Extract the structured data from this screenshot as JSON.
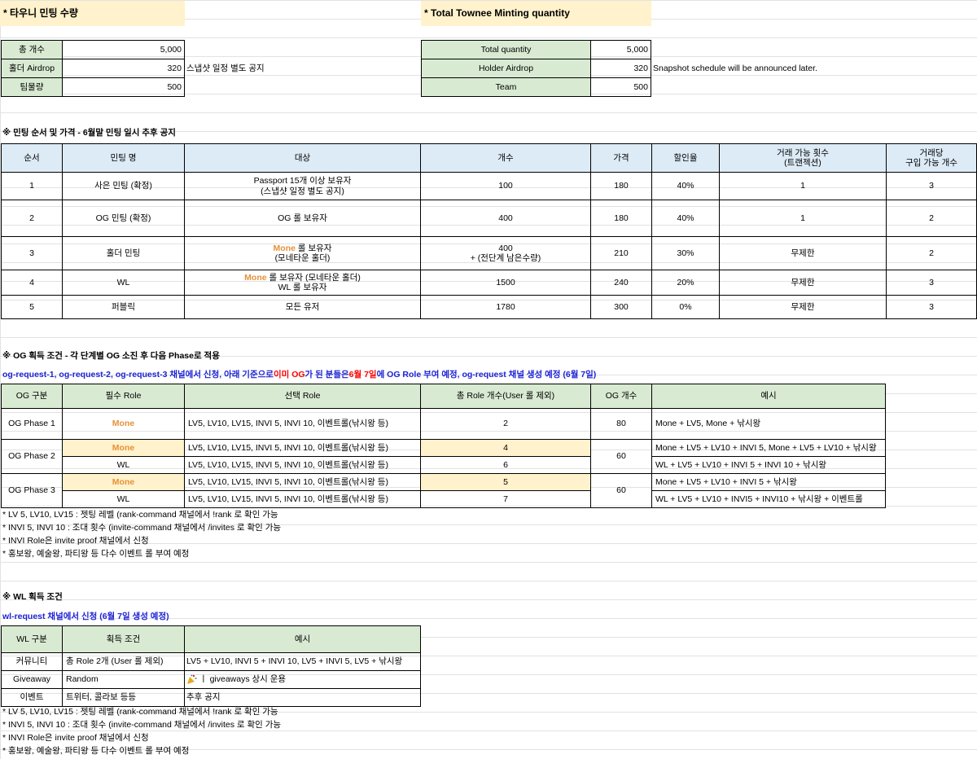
{
  "ko_title": "* 타우니 민팅 수량",
  "en_title": "* Total Townee Minting quantity",
  "ko_qty": [
    {
      "label": "총 개수",
      "value": "5,000",
      "note": ""
    },
    {
      "label": "홀더 Airdrop",
      "value": "320",
      "note": "스냅샷 일정 별도 공지"
    },
    {
      "label": "팀물량",
      "value": "500",
      "note": ""
    }
  ],
  "en_qty": [
    {
      "label": "Total quantity",
      "value": "5,000",
      "note": ""
    },
    {
      "label": "Holder Airdrop",
      "value": "320",
      "note": "Snapshot schedule will be announced later."
    },
    {
      "label": "Team",
      "value": "500",
      "note": ""
    }
  ],
  "mint_heading": "※ 민팅 순서 및 가격 - 6월말 민팅 일시 추후 공지",
  "mint_headers": [
    "순서",
    "민팅 명",
    "대상",
    "개수",
    "가격",
    "할인율",
    "거래 가능 횟수",
    "(트랜젝션)",
    "거래당",
    "구입 가능 개수"
  ],
  "mint_rows": [
    {
      "order": "1",
      "name": "사은 민팅 (확정)",
      "target1": "Passport 15개 이상 보유자",
      "target2": "(스냅샷 일정 별도 공지)",
      "qty1": "100",
      "qty2": "",
      "price": "180",
      "discount": "40%",
      "tx": "1",
      "per": "3"
    },
    {
      "order": "2",
      "name": "OG 민팅 (확정)",
      "target1": "OG 롤 보유자",
      "target2": "",
      "qty1": "400",
      "qty2": "",
      "price": "180",
      "discount": "40%",
      "tx": "1",
      "per": "2"
    },
    {
      "order": "3",
      "name": "홀더 민팅",
      "target1": "Mone",
      "target1b": " 롤 보유자",
      "target2": "(모네타운 홀더)",
      "qty1": "400",
      "qty2": "+ (전단계 남은수량)",
      "price": "210",
      "discount": "30%",
      "tx": "무제한",
      "per": "2"
    },
    {
      "order": "4",
      "name": "WL",
      "target1": "Mone",
      "target1b": " 롤 보유자 (모네타운 홀더)",
      "target2": "WL 롤 보유자",
      "qty1": "1500",
      "qty2": "",
      "price": "240",
      "discount": "20%",
      "tx": "무제한",
      "per": "3"
    },
    {
      "order": "5",
      "name": "퍼블릭",
      "target1": "모든 유저",
      "target2": "",
      "qty1": "1780",
      "qty2": "",
      "price": "300",
      "discount": "0%",
      "tx": "무제한",
      "per": "3"
    }
  ],
  "og_heading": "※ OG 획득 조건 - 각 단계별 OG 소진 후 다음 Phase로 적용",
  "og_notice": {
    "p1": "og-request-1, og-request-2, og-request-3 채널에서 신청,  아래 기준으로 ",
    "p2": "이미 OG",
    "p3": "가 된 분들은 ",
    "p4": "6월 7일",
    "p5": "에 OG Role 부여 예정,  og-request 채널 생성 예정 (6월 7일)"
  },
  "og_headers": [
    "OG 구분",
    "필수 Role",
    "선택 Role",
    "총 Role 개수(User 롤 제외)",
    "OG 개수",
    "예시"
  ],
  "og_rows": [
    {
      "phase": "OG Phase 1",
      "req": "Mone",
      "opt": "LV5, LV10, LV15, INVI 5, INVI 10, 이벤트롤(낚시왕 등)",
      "total": "2",
      "og": "80",
      "ex": "Mone + LV5, Mone + 낚시왕"
    },
    {
      "phase": "OG Phase 2",
      "req": "Mone",
      "opt": "LV5, LV10, LV15, INVI 5, INVI 10, 이벤트롤(낚시왕 등)",
      "total": "4",
      "og": "60",
      "ex": "Mone + LV5 + LV10 + INVI 5, Mone + LV5 + LV10 + 낚시왕"
    },
    {
      "phase": "",
      "req": "WL",
      "opt": "LV5, LV10, LV15, INVI 5, INVI 10, 이벤트롤(낚시왕 등)",
      "total": "6",
      "og": "",
      "ex": "WL + LV5 + LV10 + INVI 5 + INVI 10 + 낚시왕"
    },
    {
      "phase": "OG Phase 3",
      "req": "Mone",
      "opt": "LV5, LV10, LV15, INVI 5, INVI 10, 이벤트롤(낚시왕 등)",
      "total": "5",
      "og": "60",
      "ex": "Mone + LV5 + LV10 + INVI 5 + 낚시왕"
    },
    {
      "phase": "",
      "req": "WL",
      "opt": "LV5, LV10, LV15, INVI 5, INVI 10, 이벤트롤(낚시왕 등)",
      "total": "7",
      "og": "",
      "ex": "WL + LV5 + LV10 + INVI5 + INVI10 + 낚시왕 + 이벤트롤"
    }
  ],
  "notes": [
    "* LV 5, LV10, LV15 : 젯팅 레벨 (rank-command 채널에서 !rank 로 확인 가능",
    "* INVI 5, INVI 10 : 조대 횟수 (invite-command 채널에서 /invites 로 확인 가능",
    "* INVI Role은 invite proof 채널에서 신청",
    "* 홍보왕, 예술왕, 파티왕 등 다수 이벤트 롤 부여 예정"
  ],
  "wl_heading": "※ WL 획득 조건",
  "wl_notice": "wl-request 채널에서 신청 (6월 7일 생성 예정)",
  "wl_headers": [
    "WL 구분",
    "획득 조건",
    "예시"
  ],
  "wl_rows": [
    {
      "type": "커뮤니티",
      "cond": "총 Role 2개 (User 롤 제외)",
      "ex": "LV5 + LV10, INVI 5 + INVI 10, LV5 + INVI 5, LV5 + 낚시왕",
      "icon": ""
    },
    {
      "type": "Giveaway",
      "cond": "Random",
      "ex": "ㅣ giveaways 상시 운용",
      "icon": "party-popper-icon"
    },
    {
      "type": "이벤트",
      "cond": "트위터, 콜라보 등등",
      "ex": "추후 공지",
      "icon": ""
    }
  ]
}
